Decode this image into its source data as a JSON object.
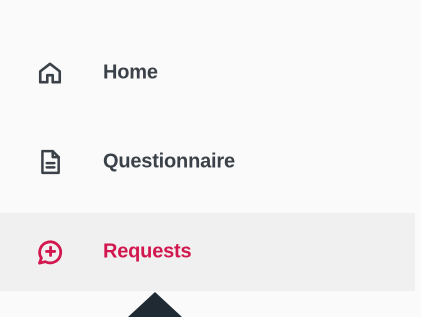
{
  "sidebar": {
    "items": [
      {
        "label": "Home",
        "icon": "home-icon",
        "active": false
      },
      {
        "label": "Questionnaire",
        "icon": "document-icon",
        "active": false
      },
      {
        "label": "Requests",
        "icon": "chat-plus-icon",
        "active": true
      }
    ]
  },
  "colors": {
    "text": "#3b4148",
    "active_text": "#d2174f",
    "active_background": "#f0f0f0",
    "background": "#fafafa",
    "tooltip": "#1f2a33"
  }
}
